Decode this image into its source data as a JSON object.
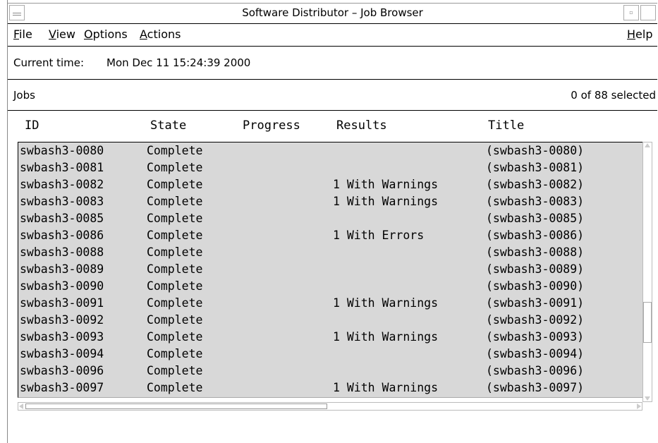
{
  "window": {
    "title": "Software Distributor – Job Browser",
    "menu_icon": "window-menu-icon",
    "min_icon": "minimize-icon",
    "max_icon": "maximize-icon"
  },
  "menubar": {
    "file_rest": "ile",
    "view_rest": "iew",
    "options_rest": "ptions",
    "actions_rest": "ctions",
    "help_rest": "elp",
    "file_u": "F",
    "view_u": "V",
    "options_u": "O",
    "actions_u": "A",
    "help_u": "H"
  },
  "status": {
    "time_label": "Current time:",
    "time_value": "Mon Dec 11 15:24:39 2000"
  },
  "jobs": {
    "label": "Jobs",
    "selected": "0 of 88 selected"
  },
  "columns": {
    "id": "ID",
    "state": "State",
    "progress": "Progress",
    "results": "Results",
    "title": "Title"
  },
  "rows": [
    {
      "id": "swbash3-0080",
      "state": "Complete",
      "progress": "",
      "results": "",
      "title": "(swbash3-0080)"
    },
    {
      "id": "swbash3-0081",
      "state": "Complete",
      "progress": "",
      "results": "",
      "title": "(swbash3-0081)"
    },
    {
      "id": "swbash3-0082",
      "state": "Complete",
      "progress": "",
      "results": "1 With Warnings",
      "title": "(swbash3-0082)"
    },
    {
      "id": "swbash3-0083",
      "state": "Complete",
      "progress": "",
      "results": "1 With Warnings",
      "title": "(swbash3-0083)"
    },
    {
      "id": "swbash3-0085",
      "state": "Complete",
      "progress": "",
      "results": "",
      "title": "(swbash3-0085)"
    },
    {
      "id": "swbash3-0086",
      "state": "Complete",
      "progress": "",
      "results": "1 With Errors",
      "title": "(swbash3-0086)"
    },
    {
      "id": "swbash3-0088",
      "state": "Complete",
      "progress": "",
      "results": "",
      "title": "(swbash3-0088)"
    },
    {
      "id": "swbash3-0089",
      "state": "Complete",
      "progress": "",
      "results": "",
      "title": "(swbash3-0089)"
    },
    {
      "id": "swbash3-0090",
      "state": "Complete",
      "progress": "",
      "results": "",
      "title": "(swbash3-0090)"
    },
    {
      "id": "swbash3-0091",
      "state": "Complete",
      "progress": "",
      "results": "1 With Warnings",
      "title": "(swbash3-0091)"
    },
    {
      "id": "swbash3-0092",
      "state": "Complete",
      "progress": "",
      "results": "",
      "title": "(swbash3-0092)"
    },
    {
      "id": "swbash3-0093",
      "state": "Complete",
      "progress": "",
      "results": "1 With Warnings",
      "title": "(swbash3-0093)"
    },
    {
      "id": "swbash3-0094",
      "state": "Complete",
      "progress": "",
      "results": "",
      "title": "(swbash3-0094)"
    },
    {
      "id": "swbash3-0096",
      "state": "Complete",
      "progress": "",
      "results": "",
      "title": "(swbash3-0096)"
    },
    {
      "id": "swbash3-0097",
      "state": "Complete",
      "progress": "",
      "results": "1 With Warnings",
      "title": "(swbash3-0097)"
    }
  ],
  "colors": {
    "list_bg": "#d8d8d8",
    "border": "#000000"
  }
}
